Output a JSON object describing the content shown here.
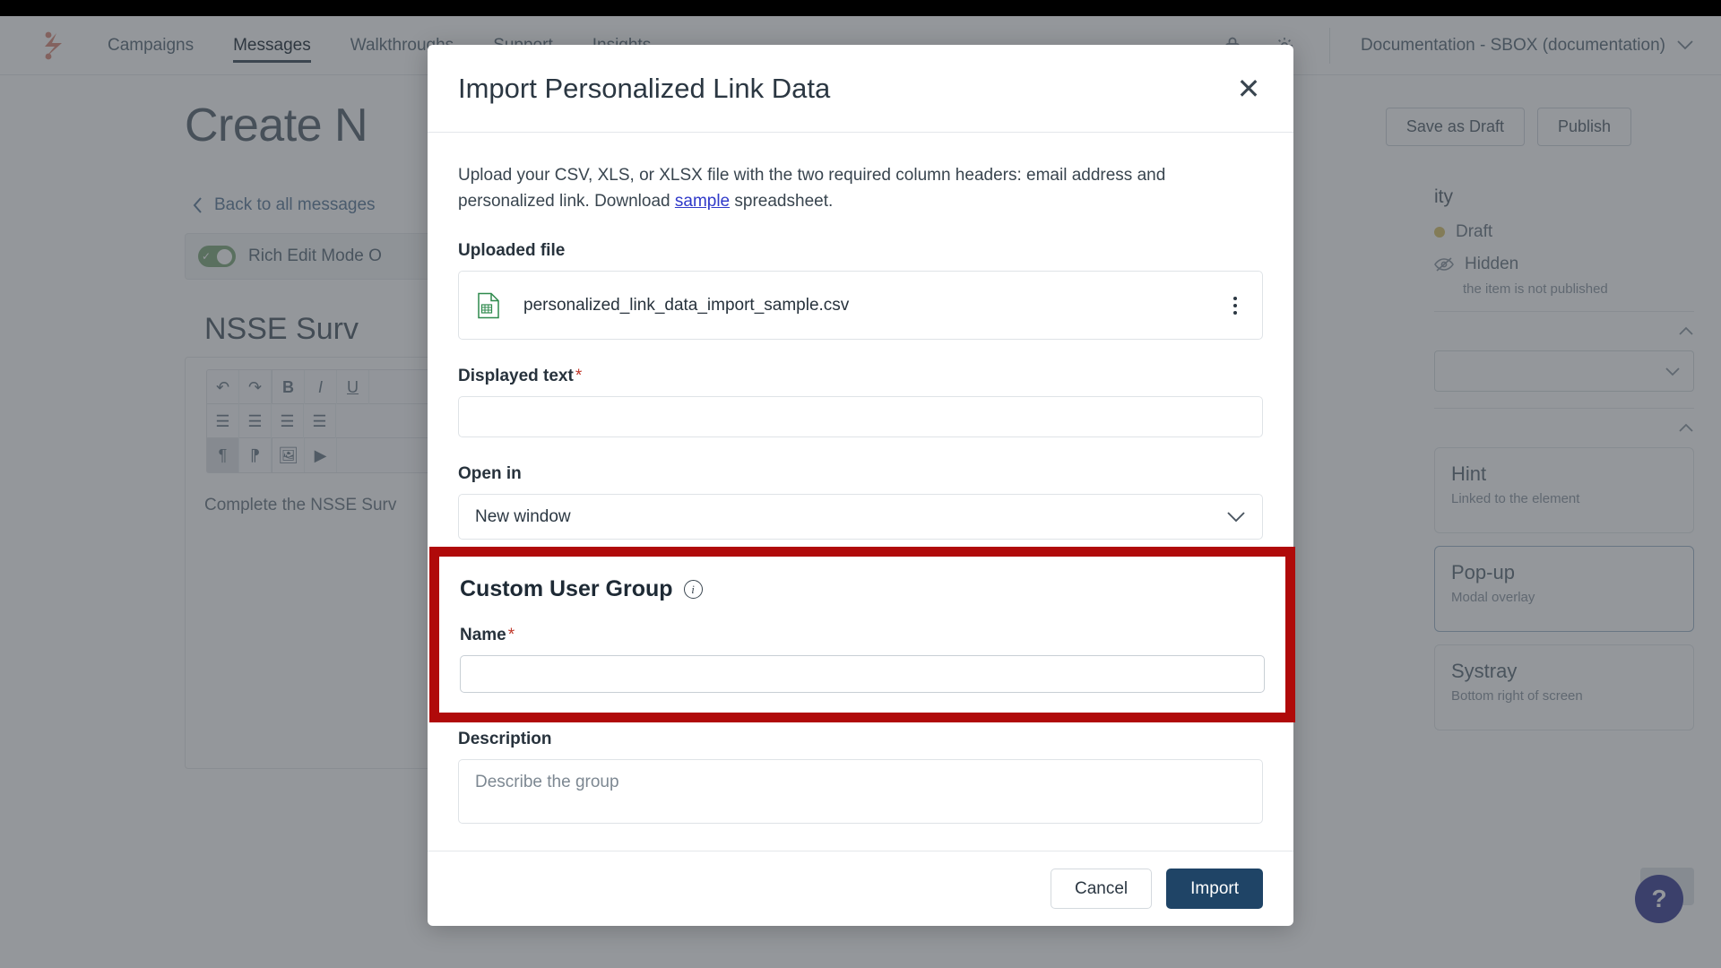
{
  "topnav": {
    "logo_name": "brand-logo",
    "items": [
      {
        "label": "Campaigns",
        "active": false
      },
      {
        "label": "Messages",
        "active": true
      },
      {
        "label": "Walkthroughs",
        "active": false
      },
      {
        "label": "Support",
        "active": false
      },
      {
        "label": "Insights",
        "active": false
      }
    ],
    "lock_icon": "lock-icon",
    "gear_icon": "gear-icon",
    "account_label": "Documentation - SBOX (documentation)",
    "account_chevron": "chevron-down-icon"
  },
  "page": {
    "title": "Create N",
    "back_link": "Back to all messages",
    "back_chevron": "chevron-left-icon",
    "rich_edit_label": "Rich Edit Mode O",
    "message_title": "NSSE Surv",
    "message_body": "Complete the NSSE Surv",
    "editor_buttons": [
      "undo-icon",
      "redo-icon",
      "bold-icon",
      "italic-icon",
      "align-left-icon",
      "align-center-icon",
      "align-right-icon",
      "align-justify-icon",
      "ltr-paragraph-icon",
      "rtl-paragraph-icon",
      "insert-image-icon",
      "insert-video-icon"
    ]
  },
  "rail": {
    "save_draft_label": "Save as Draft",
    "publish_label": "Publish",
    "visibility_heading": "ity",
    "status_label": "Draft",
    "hidden_label": "Hidden",
    "hidden_sub": "the item is not published",
    "hidden_icon": "eye-slash-icon",
    "cards": [
      {
        "title": "Hint",
        "sub": "Linked to the element",
        "selected": false
      },
      {
        "title": "Pop-up",
        "sub": "Modal overlay",
        "selected": true
      },
      {
        "title": "Systray",
        "sub": "Bottom right of screen",
        "selected": false
      }
    ]
  },
  "help": {
    "icon": "question-mark-icon",
    "label": "?"
  },
  "modal": {
    "title": "Import Personalized Link Data",
    "close_icon": "close-icon",
    "description_part1": "Upload your CSV, XLS, or XLSX file with the two required column headers: email address and personalized link. Download ",
    "description_link": "sample",
    "description_part2": " spreadsheet.",
    "uploaded_file_label": "Uploaded file",
    "file_icon": "csv-file-icon",
    "file_name": "personalized_link_data_import_sample.csv",
    "file_menu_icon": "kebab-menu-icon",
    "displayed_text_label": "Displayed text",
    "displayed_text_required": "*",
    "displayed_text_value": "",
    "open_in_label": "Open in",
    "open_in_value": "New window",
    "open_in_chevron": "chevron-down-icon",
    "description_label": "Description",
    "description_placeholder": "Describe the group",
    "description_value": "",
    "cancel_label": "Cancel",
    "import_label": "Import"
  },
  "highlight": {
    "section_title": "Custom User Group",
    "info_icon": "info-icon",
    "info_glyph": "i",
    "name_label": "Name",
    "name_required": "*",
    "name_value": "",
    "border_color": "#b00a0a"
  }
}
